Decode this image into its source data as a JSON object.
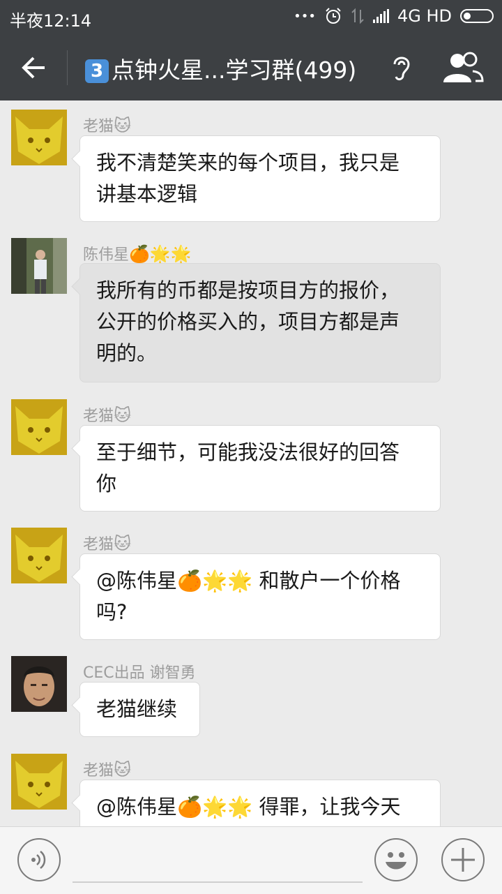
{
  "status_bar": {
    "time": "半夜12:14",
    "dots": "•••",
    "network": "4G HD"
  },
  "header": {
    "group_number": "3",
    "title": "点钟火星...学习群(499)"
  },
  "messages": [
    {
      "sender": "老猫",
      "sender_emoji": "🐱",
      "text": "我不清楚笑来的每个项目，我只是\n讲基本逻辑"
    },
    {
      "sender": "陈伟星",
      "sender_emoji": "🍊🌟🌟",
      "text": "我所有的币都是按项目方的报价，\n公开的价格买入的，项目方都是声\n明的。"
    },
    {
      "sender": "老猫",
      "sender_emoji": "🐱",
      "text": "至于细节，可能我没法很好的回答\n你"
    },
    {
      "sender": "老猫",
      "sender_emoji": "🐱",
      "text": "@陈伟星🍊🌟🌟 和散户一个价格\n吗?"
    },
    {
      "sender": "CEC出品 谢智勇",
      "sender_emoji": "",
      "text": "老猫继续"
    },
    {
      "sender": "老猫",
      "sender_emoji": "🐱",
      "text": "@陈伟星🍊🌟🌟 得罪，让我今天"
    }
  ],
  "colors": {
    "bar_bg": "#3d4043",
    "chat_bg": "#ebebeb",
    "bubble_bg": "#ffffff",
    "selected_bubble_bg": "#e2e2e2"
  },
  "icons": [
    "back-arrow-icon",
    "ear-icon",
    "group-members-icon",
    "voice-icon",
    "emoji-icon",
    "plus-icon"
  ]
}
